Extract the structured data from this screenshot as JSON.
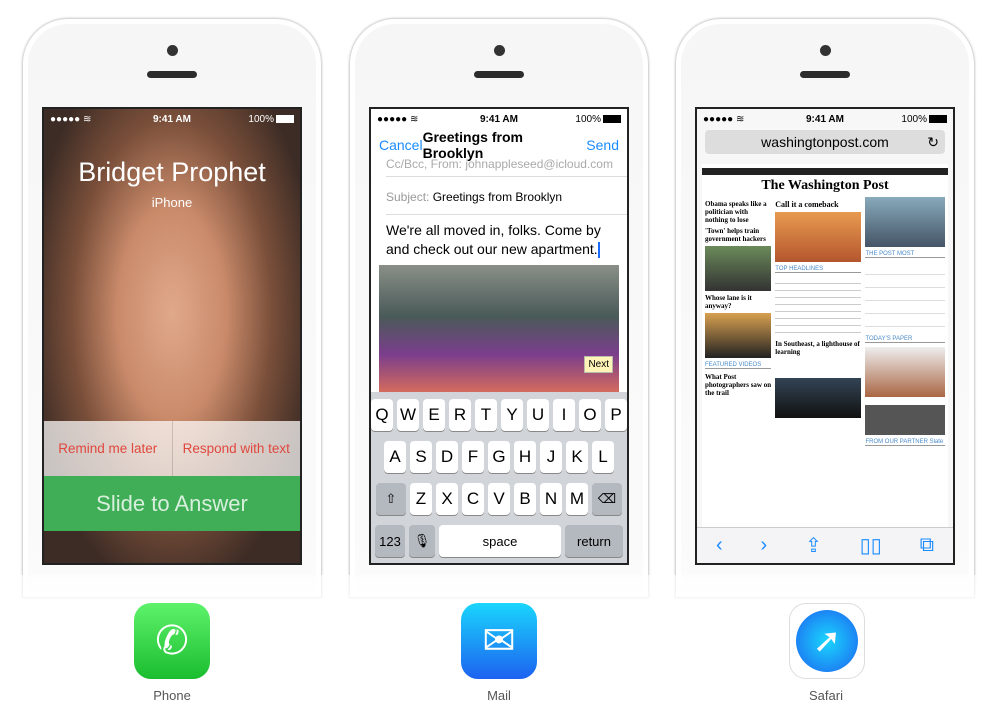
{
  "status": {
    "time": "9:41 AM",
    "battery": "100%"
  },
  "phone_call": {
    "caller": "Bridget Prophet",
    "device": "iPhone",
    "remind": "Remind me later",
    "respond": "Respond with text",
    "slide": "Slide to Answer"
  },
  "mail": {
    "cancel": "Cancel",
    "title": "Greetings from Brooklyn",
    "send": "Send",
    "ccfrom": "Cc/Bcc, From:  johnappleseed@icloud.com",
    "subject_label": "Subject:",
    "subject": "Greetings from Brooklyn",
    "body": "We're all moved in, folks. Come by and check out our new apartment.",
    "next": "Next",
    "keys": {
      "row1": [
        "Q",
        "W",
        "E",
        "R",
        "T",
        "Y",
        "U",
        "I",
        "O",
        "P"
      ],
      "row2": [
        "A",
        "S",
        "D",
        "F",
        "G",
        "H",
        "J",
        "K",
        "L"
      ],
      "row3": [
        "Z",
        "X",
        "C",
        "V",
        "B",
        "N",
        "M"
      ],
      "num": "123",
      "space": "space",
      "return": "return"
    }
  },
  "safari": {
    "url": "washingtonpost.com",
    "logo": "The Washington Post",
    "headlines": [
      "Obama speaks like a politician with nothing to lose",
      "Call it a comeback",
      "'Town' helps train government hackers",
      "Whose lane is it anyway?",
      "In Southeast, a lighthouse of learning",
      "What Post photographers saw on the trail"
    ],
    "sections": [
      "TOP HEADLINES",
      "THE POST MOST",
      "TODAY'S PAPER",
      "FEATURED VIDEOS",
      "FROM OUR PARTNER Slate"
    ]
  },
  "apps": [
    {
      "label": "Phone",
      "color": "#34c84a"
    },
    {
      "label": "Mail",
      "color": "#1e8ff5"
    },
    {
      "label": "Safari",
      "color": "#1a8cff"
    }
  ]
}
